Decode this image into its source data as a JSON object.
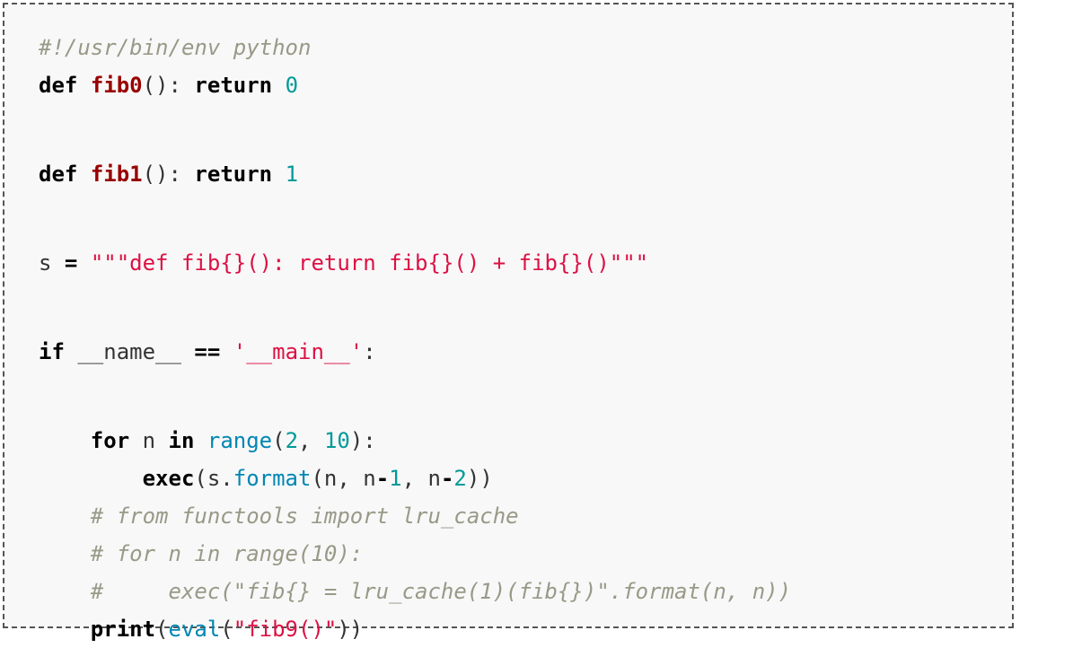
{
  "code": {
    "shebang": "#!/usr/bin/env python",
    "l2": {
      "def": "def",
      "name": "fib0",
      "paren": "():",
      "ret": "return",
      "val": "0"
    },
    "l3": {
      "def": "def",
      "name": "fib1",
      "paren": "():",
      "ret": "return",
      "val": "1"
    },
    "l4": {
      "var": "s",
      "eq": "=",
      "str": "\"\"\"def fib{}(): return fib{}() + fib{}()\"\"\""
    },
    "l5": {
      "if": "if",
      "name": "__name__",
      "eq": "==",
      "str": "'__main__'",
      "colon": ":"
    },
    "l6": {
      "for": "for",
      "n": "n",
      "in": "in",
      "range": "range",
      "open": "(",
      "a": "2",
      "comma": ",",
      "b": "10",
      "close": "):"
    },
    "l7": {
      "exec": "exec",
      "open": "(s.",
      "format": "format",
      "args1": "(n, n",
      "minus1": "-",
      "one": "1",
      "args2": ", n",
      "minus2": "-",
      "two": "2",
      "close": "))"
    },
    "c1": "# from functools import lru_cache",
    "c2": "# for n in range(10):",
    "c3": "#     exec(\"fib{} = lru_cache(1)(fib{})\".format(n, n))",
    "l8": {
      "print": "print",
      "open": "(",
      "eval": "eval",
      "open2": "(",
      "str": "\"fib9()\"",
      "close": "))"
    }
  }
}
